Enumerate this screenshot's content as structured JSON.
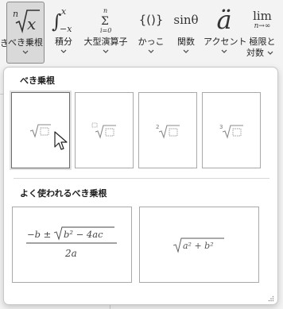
{
  "ribbon": {
    "left_cut_label": "き",
    "buttons": [
      {
        "label": "べき乗根",
        "icon_text": "ⁿ√x"
      },
      {
        "label": "積分"
      },
      {
        "label": "大型演算子"
      },
      {
        "label": "かっこ",
        "icon_text": "{()}"
      },
      {
        "label": "関数",
        "icon_text": "sinθ"
      },
      {
        "label": "アクセント",
        "icon_text": "ä"
      },
      {
        "label": "極限と",
        "label2": "対数",
        "icon_text": "lim",
        "icon_sub": "n→∞"
      }
    ],
    "integral_limits": {
      "upper": "x",
      "lower": "−x"
    },
    "sum_limits": {
      "upper": "n",
      "lower": "i=0"
    }
  },
  "panel": {
    "section1_title": "べき乗根",
    "section2_title": "よく使われるべき乗根",
    "radicals": [
      {
        "index": ""
      },
      {
        "index": "□"
      },
      {
        "index": "2"
      },
      {
        "index": "3"
      }
    ],
    "common": {
      "quadratic": {
        "numerator": "−b ± √b² − 4ac",
        "minus_b": "−b ±",
        "radicand": "b² − 4ac",
        "denominator": "2a"
      },
      "pythag": {
        "radicand": "a² + b²"
      }
    }
  }
}
